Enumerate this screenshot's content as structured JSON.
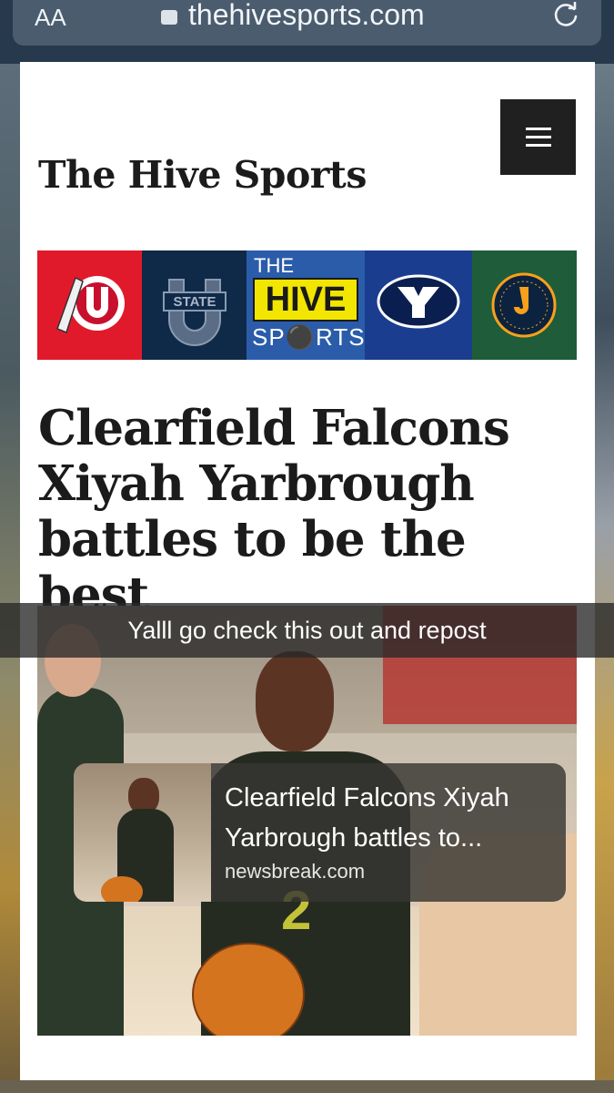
{
  "browser": {
    "aa_label": "AA",
    "url": "thehivesports.com"
  },
  "site": {
    "title": "The Hive Sports"
  },
  "banner": {
    "hive_the": "THE",
    "hive_big": "HIVE",
    "hive_sports": "SP⚫RTS",
    "usu_text": "STATE",
    "jazz_text": "UTAH JAZZ BASKETBALL"
  },
  "article": {
    "headline": "Clearfield Falcons Xiyah Yarbrough battles to be the best"
  },
  "story": {
    "caption": "Yalll go check this out and repost"
  },
  "link_sticker": {
    "title": "Clearfield Falcons Xiyah Yarbrough battles to...",
    "domain": "newsbreak.com"
  },
  "image": {
    "jersey_number": "2"
  }
}
